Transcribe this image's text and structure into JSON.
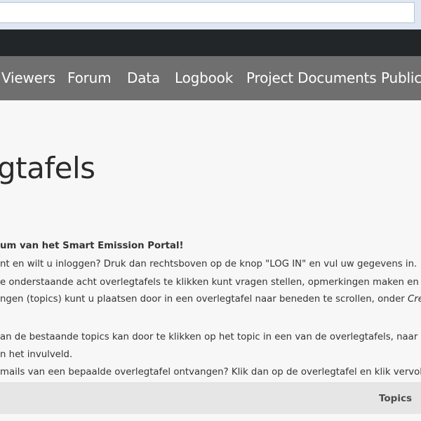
{
  "nav": {
    "items": [
      {
        "label": "Viewers"
      },
      {
        "label": "Forum"
      },
      {
        "label": "Data"
      },
      {
        "label": "Logbook"
      },
      {
        "label": "Project Documents"
      },
      {
        "label": "Publica"
      }
    ]
  },
  "page": {
    "title": "gtafels"
  },
  "intro": {
    "line1": "um van het Smart Emission Portal!",
    "line2": "nt en wilt u inloggen? Druk dan rechtsboven op de knop \"LOG IN\" en vul uw gegevens in.",
    "line3": "e onderstaande acht overlegtafels te klikken kunt vragen stellen, opmerkingen maken en updat",
    "line4_pre": "ngen (topics) kunt u plaatsen door in een overlegtafel naar beneden te scrollen, onder ",
    "line4_em": "Create N",
    "line5": "an de bestaande topics kan door te klikken op het topic in een van de overlegtafels, naar bened",
    "line6": "n het invulveld.",
    "line7": " mails van een bepaalde overlegtafel ontvangen? Klik dan op de overlegtafel en klik vervolgens"
  },
  "table": {
    "topics_header": "Topics"
  }
}
